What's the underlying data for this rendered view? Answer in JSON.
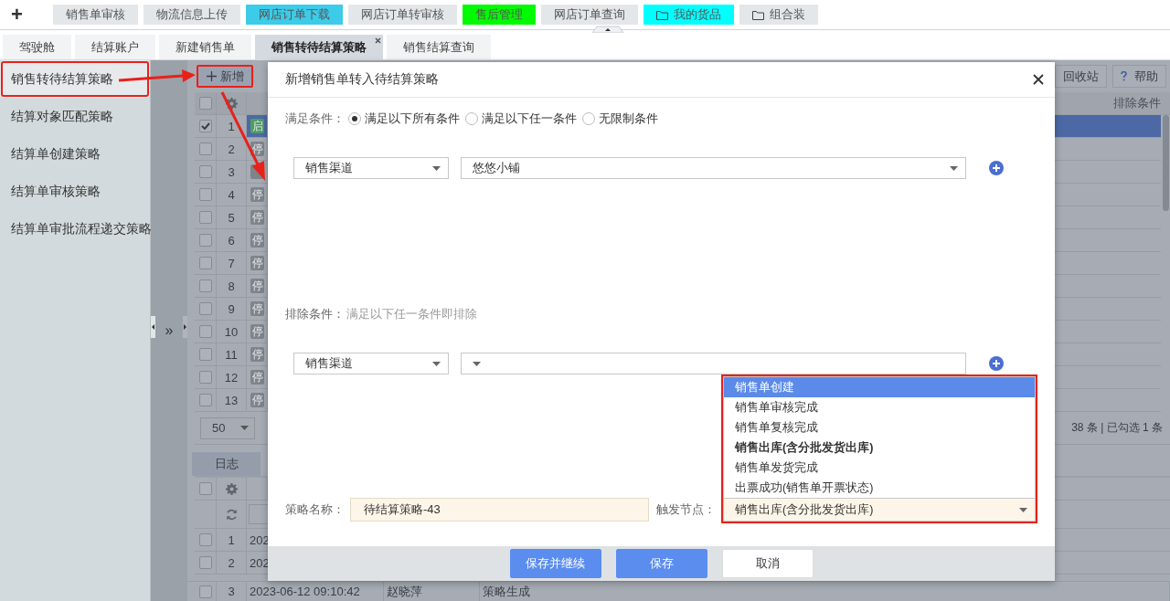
{
  "new_tab": "+",
  "quick_buttons": [
    {
      "label": "销售单审核",
      "color": "#e4e7ea",
      "kind": "plain"
    },
    {
      "label": "物流信息上传",
      "color": "#e4e7ea",
      "kind": "plain"
    },
    {
      "label": "网店订单下载",
      "color": "#3ccbe9",
      "kind": "plain"
    },
    {
      "label": "网店订单转审核",
      "color": "#e4e7ea",
      "kind": "plain"
    },
    {
      "label": "售后管理",
      "color": "#00fb00",
      "kind": "plain"
    },
    {
      "label": "网店订单查询",
      "color": "#e4e7ea",
      "kind": "plain"
    },
    {
      "label": "我的货品",
      "color": "#00ffff",
      "kind": "folder"
    },
    {
      "label": "组合装",
      "color": "#e4e7ea",
      "kind": "folder"
    }
  ],
  "tabs": [
    {
      "label": "驾驶舱",
      "selected": false
    },
    {
      "label": "结算账户",
      "selected": false
    },
    {
      "label": "新建销售单",
      "selected": false
    },
    {
      "label": "销售转待结算策略",
      "selected": true
    },
    {
      "label": "销售结算查询",
      "selected": false
    }
  ],
  "sidebar": {
    "items": [
      {
        "label": "销售转待结算策略",
        "selected": true,
        "annotated": true
      },
      {
        "label": "结算对象匹配策略",
        "selected": false,
        "annotated": false
      },
      {
        "label": "结算单创建策略",
        "selected": false,
        "annotated": false
      },
      {
        "label": "结算单审核策略",
        "selected": false,
        "annotated": false
      },
      {
        "label": "结算单审批流程递交策略",
        "selected": false,
        "annotated": false
      }
    ]
  },
  "expander": "»",
  "list": {
    "add_button": {
      "label": "新增",
      "annotated": true
    },
    "recycle_button": "回收站",
    "help_button": "帮助",
    "column_header": "排除条件",
    "rows": [
      {
        "number": "1",
        "checked": true,
        "selected": true,
        "status": "启",
        "color": "#4f9e64"
      },
      {
        "number": "2",
        "checked": false,
        "selected": false,
        "status": "停",
        "color": "#7f848b"
      },
      {
        "number": "3",
        "checked": false,
        "selected": false,
        "color": "#7f848b"
      },
      {
        "number": "4",
        "checked": false,
        "selected": false,
        "status": "停",
        "color": "#7f848b"
      },
      {
        "number": "5",
        "checked": false,
        "selected": false,
        "status": "停",
        "color": "#7f848b"
      },
      {
        "number": "6",
        "checked": false,
        "selected": false,
        "status": "停",
        "color": "#7f848b"
      },
      {
        "number": "7",
        "checked": false,
        "selected": false,
        "status": "停",
        "color": "#7f848b"
      },
      {
        "number": "8",
        "checked": false,
        "selected": false,
        "status": "停",
        "color": "#7f848b"
      },
      {
        "number": "9",
        "checked": false,
        "selected": false,
        "status": "停",
        "color": "#7f848b"
      },
      {
        "number": "10",
        "checked": false,
        "selected": false,
        "status": "停",
        "color": "#7f848b"
      },
      {
        "number": "11",
        "checked": false,
        "selected": false,
        "status": "停",
        "color": "#7f848b"
      },
      {
        "number": "12",
        "checked": false,
        "selected": false,
        "status": "停",
        "color": "#7f848b"
      },
      {
        "number": "13",
        "checked": false,
        "selected": false,
        "status": "停",
        "color": "#7f848b"
      }
    ],
    "header_checked": false,
    "page_size": "50",
    "summary": "38 条 | 已勾选 1 条"
  },
  "log": {
    "tab": "日志",
    "header_checked": false,
    "rows": [
      {
        "number": "1",
        "checked": false,
        "time": "202"
      },
      {
        "number": "2",
        "checked": false,
        "time": "202"
      },
      {
        "number": "3",
        "checked": false,
        "time": "2023-06-12 09:10:42",
        "operator": "赵晓萍",
        "action": "策略生成"
      }
    ]
  },
  "dialog": {
    "title": "新增销售单转入待结算策略",
    "match": {
      "label": "满足条件：",
      "options": [
        {
          "label": "满足以下所有条件",
          "selected": true
        },
        {
          "label": "满足以下任一条件",
          "selected": false
        },
        {
          "label": "无限制条件",
          "selected": false
        }
      ]
    },
    "conditions": [
      {
        "field": "销售渠道",
        "value": "悠悠小铺"
      }
    ],
    "exclusion": {
      "label": "排除条件：",
      "hint": "满足以下任一条件即排除"
    },
    "exclusions": [
      {
        "field": "销售渠道"
      }
    ],
    "name": {
      "label": "策略名称：",
      "value": "待结算策略-43"
    },
    "trigger": {
      "label": "触发节点：",
      "value": "销售出库(含分批发货出库)",
      "expanded": true,
      "annotated": true,
      "options": [
        {
          "label": "销售单创建",
          "highlighted": true,
          "selected": false
        },
        {
          "label": "销售单审核完成",
          "highlighted": false,
          "selected": false
        },
        {
          "label": "销售单复核完成",
          "highlighted": false,
          "selected": false
        },
        {
          "label": "销售出库(含分批发货出库)",
          "highlighted": false,
          "selected": true
        },
        {
          "label": "销售单发货完成",
          "highlighted": false,
          "selected": false
        },
        {
          "label": "出票成功(销售单开票状态)",
          "highlighted": false,
          "selected": false
        }
      ]
    },
    "buttons": [
      {
        "label": "保存并继续",
        "kind": "primary"
      },
      {
        "label": "保存",
        "kind": "primary"
      },
      {
        "label": "取消",
        "kind": "default"
      }
    ]
  }
}
